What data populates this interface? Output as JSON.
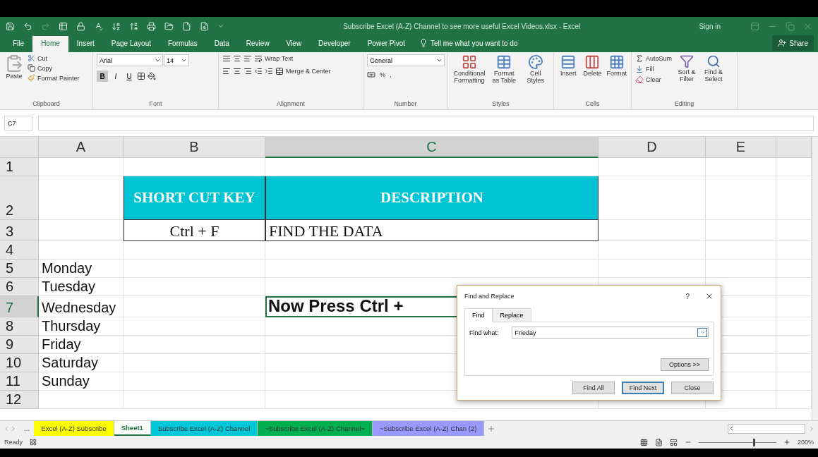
{
  "title_bar": {
    "title": "Subscribe Excel (A-Z) Channel to see more useful Excel Videos.xlsx  -  Excel",
    "sign_in": "Sign in"
  },
  "menu_tabs": [
    {
      "label": "File",
      "selected": false
    },
    {
      "label": "Home",
      "selected": true
    },
    {
      "label": "Insert",
      "selected": false
    },
    {
      "label": "Page Layout",
      "selected": false
    },
    {
      "label": "Formulas",
      "selected": false
    },
    {
      "label": "Data",
      "selected": false
    },
    {
      "label": "Review",
      "selected": false
    },
    {
      "label": "View",
      "selected": false
    },
    {
      "label": "Developer",
      "selected": false
    },
    {
      "label": "Power Pivot",
      "selected": false
    }
  ],
  "tell_me": "Tell me what you want to do",
  "share": "Share",
  "ribbon": {
    "clipboard": {
      "paste": "Paste",
      "cut": "Cut",
      "copy": "Copy",
      "format_painter": "Format Painter",
      "label": "Clipboard"
    },
    "font": {
      "font_name": "Arial",
      "font_size": "14",
      "styles": [
        {
          "label": "B",
          "on": true
        },
        {
          "label": "I",
          "on": false
        },
        {
          "label": "U",
          "on": false
        }
      ],
      "label": "Font"
    },
    "alignment": {
      "wrap_text": "Wrap Text",
      "merge_center": "Merge & Center",
      "label": "Alignment"
    },
    "number": {
      "format": "General",
      "percent": "%",
      "comma": ",",
      "label": "Number"
    },
    "styles": {
      "buttons": [
        "Conditional Formatting",
        "Format as Table",
        "Cell Styles"
      ],
      "label": "Styles"
    },
    "cells": {
      "buttons": [
        "Insert",
        "Delete",
        "Format"
      ],
      "label": "Cells"
    },
    "editing": {
      "autosum": "AutoSum",
      "fill": "Fill",
      "clear": "Clear",
      "sort_filter": "Sort & Filter",
      "find_select": "Find & Select",
      "label": "Editing"
    }
  },
  "formula_bar": {
    "name_box": "C7"
  },
  "columns": [
    {
      "label": "A",
      "selected": false
    },
    {
      "label": "B",
      "selected": false
    },
    {
      "label": "C",
      "selected": true
    },
    {
      "label": "D",
      "selected": false
    },
    {
      "label": "E",
      "selected": false
    }
  ],
  "rows": [
    {
      "number": "1",
      "selected": false
    },
    {
      "number": "2",
      "selected": false,
      "b": {
        "text": "SHORT CUT KEY",
        "kind": "heading"
      },
      "c": {
        "text": "DESCRIPTION",
        "kind": "heading"
      }
    },
    {
      "number": "3",
      "selected": false,
      "b": {
        "text": "Ctrl + F",
        "kind": "key"
      },
      "c": {
        "text": "FIND THE DATA",
        "kind": "entry"
      }
    },
    {
      "number": "4",
      "selected": false
    },
    {
      "number": "5",
      "selected": false,
      "a": {
        "text": "Monday",
        "kind": "label"
      }
    },
    {
      "number": "6",
      "selected": false,
      "a": {
        "text": "Tuesday",
        "kind": "label"
      }
    },
    {
      "number": "7",
      "selected": true,
      "a": {
        "text": "Wednesday",
        "kind": "label"
      },
      "c": {
        "text": "Now Press Ctrl +",
        "kind": "callout",
        "selected": true
      }
    },
    {
      "number": "8",
      "selected": false,
      "a": {
        "text": "Thursday",
        "kind": "label"
      }
    },
    {
      "number": "9",
      "selected": false,
      "a": {
        "text": "Friday",
        "kind": "label"
      }
    },
    {
      "number": "10",
      "selected": false,
      "a": {
        "text": "Saturday",
        "kind": "label"
      }
    },
    {
      "number": "11",
      "selected": false,
      "a": {
        "text": "Sunday",
        "kind": "label"
      }
    },
    {
      "number": "12",
      "selected": false
    }
  ],
  "dialog": {
    "title": "Find and Replace",
    "help": "?",
    "tabs": [
      {
        "label": "Find",
        "selected": true
      },
      {
        "label": "Replace",
        "selected": false
      }
    ],
    "find_label": "Find what:",
    "find_value": "Frieday",
    "options": "Options >>",
    "buttons": [
      {
        "label": "Find All",
        "default": false
      },
      {
        "label": "Find Next",
        "default": true
      },
      {
        "label": "Close",
        "default": false
      }
    ]
  },
  "sheet_tabs": {
    "more": "...",
    "tabs": [
      {
        "label": "Excel (A-Z) Subscribe",
        "selected": false,
        "color": "#ffff00"
      },
      {
        "label": "Sheet1",
        "selected": true,
        "color": "#ffffff"
      },
      {
        "label": "Subscribe Excel (A-Z) Channel",
        "selected": false,
        "color": "#00c8d8"
      },
      {
        "label": "~Subscribe Excel (A-Z) Channel~",
        "selected": false,
        "color": "#00b050"
      },
      {
        "label": "~Subscribe Excel (A-Z) Chan (2)",
        "selected": false,
        "color": "#9999ff"
      }
    ]
  },
  "status_bar": {
    "status": "Ready",
    "zoom": {
      "level": 0.7,
      "reading": "200%"
    }
  }
}
